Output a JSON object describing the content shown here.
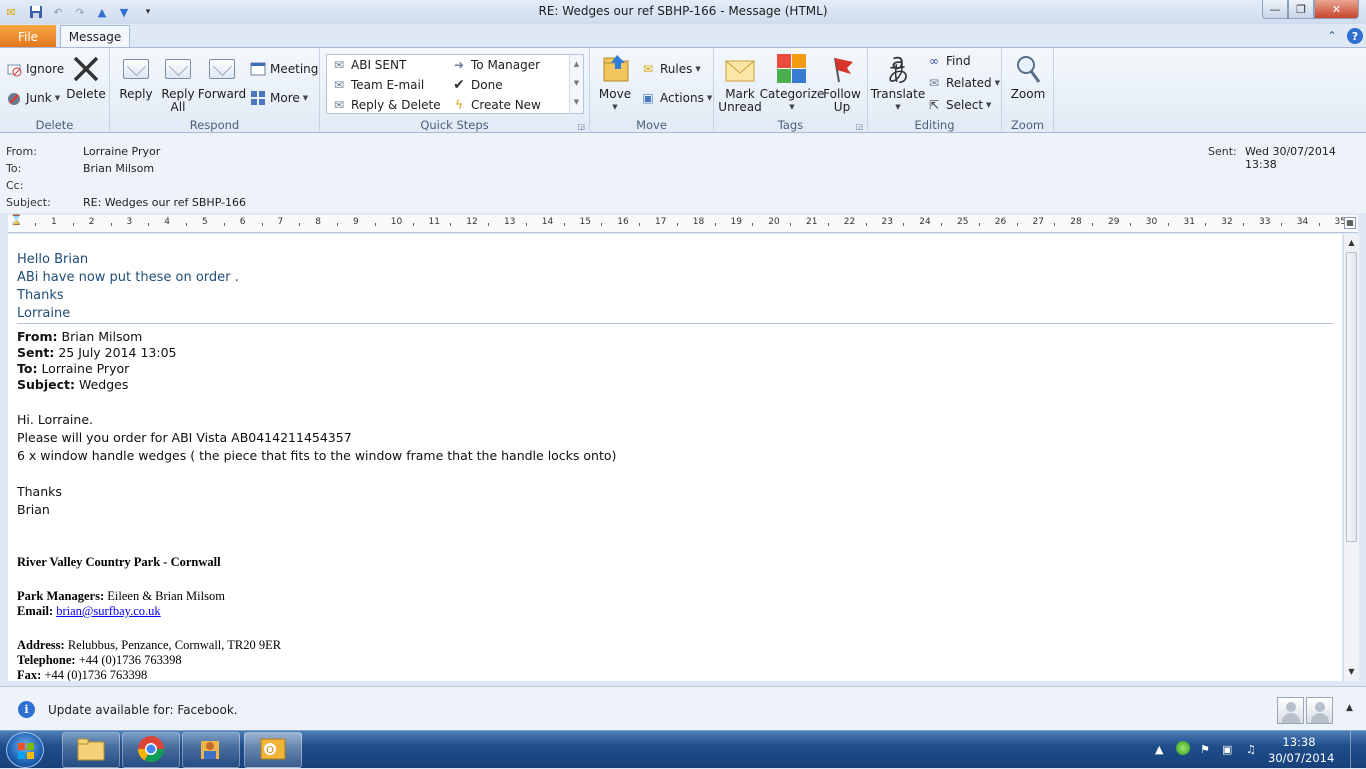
{
  "window": {
    "title": "RE: Wedges our ref SBHP-166  -  Message (HTML)",
    "controls": {
      "minimize": "—",
      "maximize": "❐",
      "close": "✕"
    }
  },
  "tabs": {
    "file": "File",
    "message": "Message"
  },
  "ribbon": {
    "delete_group": {
      "label": "Delete",
      "ignore": "Ignore",
      "junk": "Junk",
      "delete": "Delete"
    },
    "respond_group": {
      "label": "Respond",
      "reply": "Reply",
      "reply_all_1": "Reply",
      "reply_all_2": "All",
      "forward": "Forward",
      "meeting": "Meeting",
      "more": "More"
    },
    "quick_steps": {
      "label": "Quick Steps",
      "items": [
        "ABI SENT",
        "To Manager",
        "Team E-mail",
        "Done",
        "Reply & Delete",
        "Create New"
      ]
    },
    "move_group": {
      "label": "Move",
      "move": "Move",
      "rules": "Rules",
      "actions": "Actions"
    },
    "tags_group": {
      "label": "Tags",
      "mark_unread_1": "Mark",
      "mark_unread_2": "Unread",
      "categorize": "Categorize",
      "follow_up_1": "Follow",
      "follow_up_2": "Up"
    },
    "editing_group": {
      "label": "Editing",
      "translate": "Translate",
      "find": "Find",
      "related": "Related",
      "select": "Select"
    },
    "zoom_group": {
      "label": "Zoom",
      "zoom": "Zoom"
    }
  },
  "header": {
    "from_label": "From:",
    "from": "Lorraine Pryor",
    "to_label": "To:",
    "to": "Brian Milsom",
    "cc_label": "Cc:",
    "subject_label": "Subject:",
    "subject": "RE: Wedges our ref SBHP-166",
    "sent_label": "Sent:",
    "sent": "Wed 30/07/2014 13:38"
  },
  "ruler": {
    "numbers": [
      "1",
      "2",
      "3",
      "4",
      "5",
      "6",
      "7",
      "8",
      "9",
      "10",
      "11",
      "12",
      "13",
      "14",
      "15",
      "16",
      "17",
      "18",
      "19",
      "20",
      "21",
      "22",
      "23",
      "24",
      "25",
      "26",
      "27",
      "28",
      "29",
      "30",
      "31",
      "32",
      "33",
      "34",
      "35"
    ]
  },
  "body": {
    "reply": [
      "Hello Brian",
      "ABi have now put these on order .",
      "Thanks",
      "Lorraine"
    ],
    "quoted_header": {
      "from_label": "From:",
      "from": "Brian Milsom",
      "sent_label": "Sent:",
      "sent": "25 July 2014 13:05",
      "to_label": "To:",
      "to": "Lorraine Pryor",
      "subject_label": "Subject:",
      "subject": "Wedges"
    },
    "original": [
      "Hi. Lorraine.",
      "Please will you order for ABI Vista AB0414211454357",
      "6 x window handle wedges ( the piece that fits to the window frame that the handle locks onto)",
      "Thanks",
      "Brian"
    ],
    "signature": {
      "park": "River Valley Country Park - Cornwall",
      "managers_label": "Park Managers:",
      "managers": "Eileen & Brian Milsom",
      "email_label": "Email:",
      "email": "brian@surfbay.co.uk",
      "address_label": "Address:",
      "address": "Relubbus, Penzance, Cornwall, TR20 9ER",
      "telephone_label": "Telephone:",
      "telephone": "+44 (0)1736 763398",
      "fax_label": "Fax:",
      "fax": "+44 (0)1736 763398"
    }
  },
  "people_pane": {
    "update_text": "Update available for: Facebook."
  },
  "taskbar": {
    "time": "13:38",
    "date": "30/07/2014"
  },
  "colors": {
    "file_tab": "#e2751c",
    "reply_text": "#1f4e79",
    "link": "#0000ee",
    "taskbar": "#1f4e8a"
  }
}
